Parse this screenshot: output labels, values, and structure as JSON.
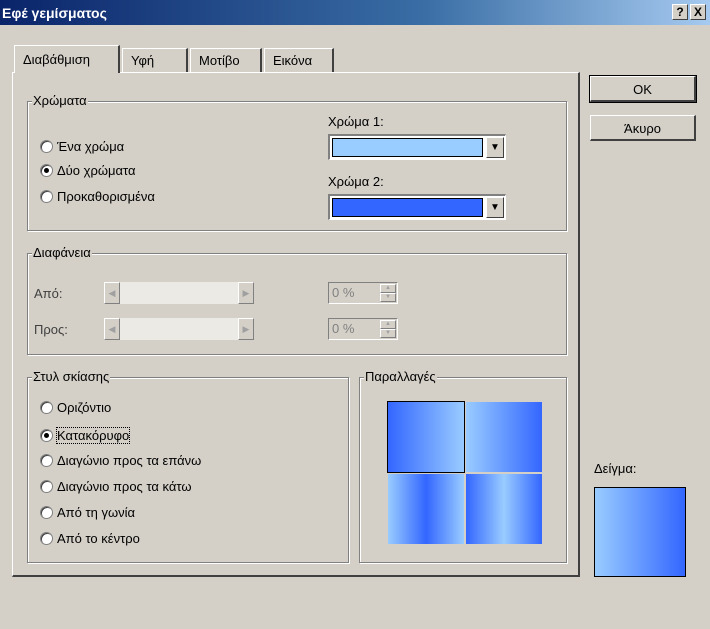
{
  "title": "Εφέ γεμίσματος",
  "titlebar_buttons": {
    "help": "?",
    "close": "X"
  },
  "tabs": [
    "Διαβάθμιση",
    "Υφή",
    "Μοτίβο",
    "Εικόνα"
  ],
  "colors_group": {
    "label": "Χρώματα",
    "options": [
      "Ένα χρώμα",
      "Δύο χρώματα",
      "Προκαθορισμένα"
    ],
    "selected_option": "Δύο χρώματα",
    "color1_label": "Χρώμα 1:",
    "color2_label": "Χρώμα 2:",
    "color1_value": "#99ccff",
    "color2_value": "#3366ff"
  },
  "transparency_group": {
    "label": "Διαφάνεια",
    "from_label": "Από:",
    "to_label": "Προς:",
    "from_value": "0 %",
    "to_value": "0 %"
  },
  "shading_group": {
    "label": "Στυλ σκίασης",
    "options": [
      "Οριζόντιο",
      "Κατακόρυφο",
      "Διαγώνιο προς τα επάνω",
      "Διαγώνιο προς τα κάτω",
      "Από τη γωνία",
      "Από το κέντρο"
    ],
    "selected_option": "Κατακόρυφο"
  },
  "variants_group": {
    "label": "Παραλλαγές"
  },
  "buttons": {
    "ok": "OK",
    "cancel": "Άκυρο"
  },
  "sample_label": "Δείγμα:",
  "accent_colors": {
    "title_bar": "#0a246a",
    "gradient_light": "#99ccff",
    "gradient_dark": "#3366ff"
  }
}
